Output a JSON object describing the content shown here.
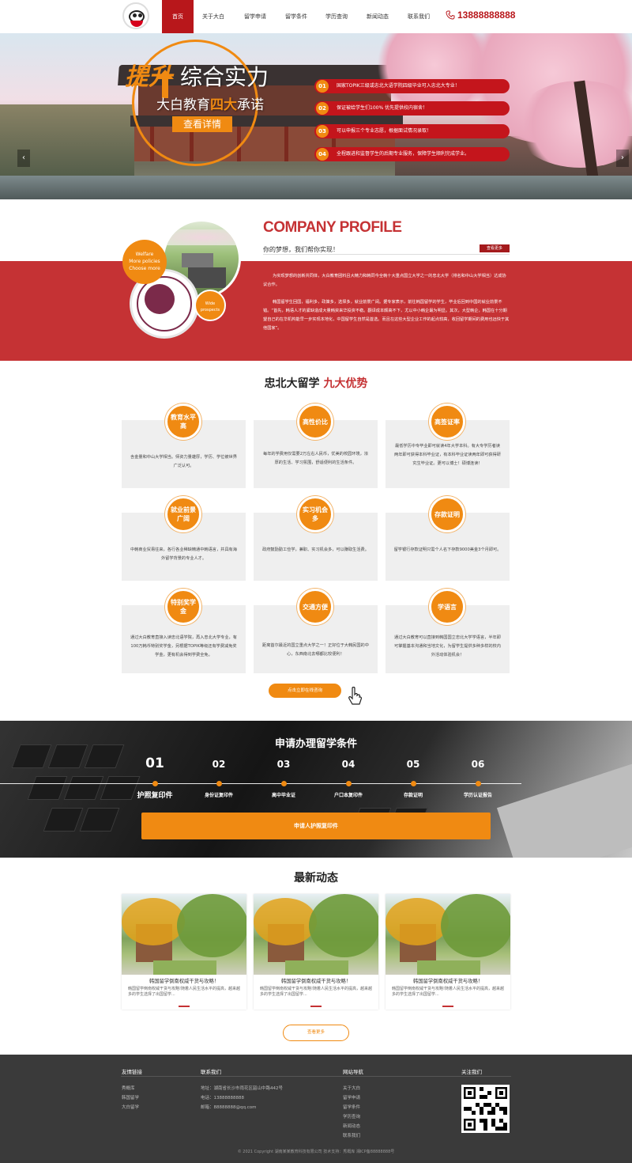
{
  "header": {
    "nav": [
      {
        "label": "首页",
        "active": true
      },
      {
        "label": "关于大白",
        "active": false
      },
      {
        "label": "留学申请",
        "active": false
      },
      {
        "label": "留学条件",
        "active": false
      },
      {
        "label": "学历查询",
        "active": false
      },
      {
        "label": "新闻动态",
        "active": false
      },
      {
        "label": "联系我们",
        "active": false
      }
    ],
    "phone": "13888888888"
  },
  "banner": {
    "title_highlight": "提升",
    "title_rest": "综合实力",
    "subtitle_a": "大白教育",
    "subtitle_b": "四大",
    "subtitle_c": "承诺",
    "button": "查看详情",
    "promises": [
      {
        "num": "01",
        "text": "国家TOPIK三级或忠北大语学院四级毕业可入忠北大专业！"
      },
      {
        "num": "02",
        "text": "保证被给学生们100% 优先提供校内宿舍！"
      },
      {
        "num": "03",
        "text": "可以申报三个专业志愿，根据面试情况录取！"
      },
      {
        "num": "04",
        "text": "全程跟进和监督学生的后期专业服务，保障学生顺利完成学业。"
      }
    ]
  },
  "profile": {
    "title": "COMPANY PROFILE",
    "subtitle": "你的梦想，我们帮你实现！",
    "more": "查看更多",
    "paragraphs": [
      "为实现梦想的创新共同体，大白教育团料且大精力和韩同今全韩十大重点国立大学之一的忠北大学（排名和中山大学相当）达成协议合作。",
      "韩国留学生回国，福利多，政策多，选择多，就业前景广阔。据专家表示，前往韩国留学的学生，毕业后回到中国的就业前景不错。“首先，韩语人才的紧缺造成大量韩资来华投资不稳。翻译成本颇高不下，尤以中小韩企最为明显。其次，大型韩企，韩国在十分期望自己的在华机构能早一步实现本地化，中国留学生自然是首选。而且在这些大型企业工作的起点较高，收回留学期间的费用也远快于其他国家”。"
    ],
    "welfare_lines": [
      "Welfare",
      "More policies",
      "Choose more"
    ],
    "wide_lines": [
      "Wide",
      "prospects"
    ]
  },
  "advantages": {
    "title_a": "忠北大留学",
    "title_b": "九大优势",
    "items": [
      {
        "title": "教育水平高",
        "text": "含金量和中山大学相当。师资力量雄厚，学历、学位被世界广泛认可。"
      },
      {
        "title": "高性价比",
        "text": "每年的学费用仅需要2万左右人民币，优美的校园环境，浓厚的生活、学习氛围，舒适便利的生活条件。"
      },
      {
        "title": "高签证率",
        "text": "最低学历中专毕业即可就读4年大学本科。有大专学历者读两年即可获得本科毕业证，有本科毕业证读两年即可获得研究生毕业证。更可以博士！硕博连读！"
      },
      {
        "title": "就业前景广阔",
        "text": "中韩商业贸易往来，各行各业稀缺精通中韩语言，并具有海外留学背景的专业人才。"
      },
      {
        "title": "实习机会多",
        "text": "政府鼓励勤工俭学，兼职、实习机会多，可以赚取生活费。"
      },
      {
        "title": "存款证明",
        "text": "留学银行存款证明只需个人名下存款9000美金3个月即可。"
      },
      {
        "title": "特别奖学金",
        "text": "通过大白教育直接入读忠北语学院，再入忠北大学专业，有100万韩币特别奖学金，另根据TOPIK等级还有学费减免奖学金，更有机会得到学费全免。"
      },
      {
        "title": "交通方便",
        "text": "距离首尔最近的国立重点大学之一！正好位于大韩民国的中心，东西南北去哪都比较便利！"
      },
      {
        "title": "学语言",
        "text": "通过大白教育可以直接到韩国国立忠北大学学语言，半年即可掌握基本沟通和当地文化，为留学生提供多种多样的校内外活动体验机会！"
      }
    ],
    "consult_button": "点击立即在线咨询"
  },
  "conditions": {
    "title": "申请办理留学条件",
    "steps": [
      {
        "num": "01",
        "label": "护照复印件"
      },
      {
        "num": "02",
        "label": "身份证复印件"
      },
      {
        "num": "03",
        "label": "高中毕业证"
      },
      {
        "num": "04",
        "label": "户口本复印件"
      },
      {
        "num": "05",
        "label": "存款证明"
      },
      {
        "num": "06",
        "label": "学历认证报告"
      }
    ],
    "apply_button": "申请人护照复印件"
  },
  "news": {
    "title": "最新动态",
    "items": [
      {
        "title": "韩国留学倒南权威干货与攻略！",
        "desc": "韩国留学倒南权威干货与攻略!随着人民生活水平的提高，越来越多的学生选择了出国留学..."
      },
      {
        "title": "韩国留学倒南权威干货与攻略！",
        "desc": "韩国留学倒南权威干货与攻略!随着人民生活水平的提高，越来越多的学生选择了出国留学..."
      },
      {
        "title": "韩国留学倒南权威干货与攻略！",
        "desc": "韩国留学倒南权威干货与攻略!随着人民生活水平的提高，越来越多的学生选择了出国留学..."
      }
    ],
    "more": "查看更多"
  },
  "footer": {
    "links_title": "友情链接",
    "links": [
      "秀概库",
      "韩国留学",
      "大白留学"
    ],
    "contact_title": "联系我们",
    "contact": [
      "地址：湖南省长沙市雨花区韶山中路442号",
      "电话：13888888888",
      "邮箱：88888888@qq.com"
    ],
    "sitemap_title": "网站导航",
    "sitemap": [
      "关于大白",
      "留学申请",
      "留学条件",
      "学历查询",
      "新闻动态",
      "联系我们"
    ],
    "follow_title": "关注我们",
    "copyright": "© 2021 Copyright 湖南某某教育科技有限公司 技术支持：秀概库 湘ICP备88888888号"
  },
  "colors": {
    "brand_red": "#b8171b",
    "accent_orange": "#f08a12",
    "profile_red": "#c53234",
    "footer_bg": "#3a3a3a"
  }
}
